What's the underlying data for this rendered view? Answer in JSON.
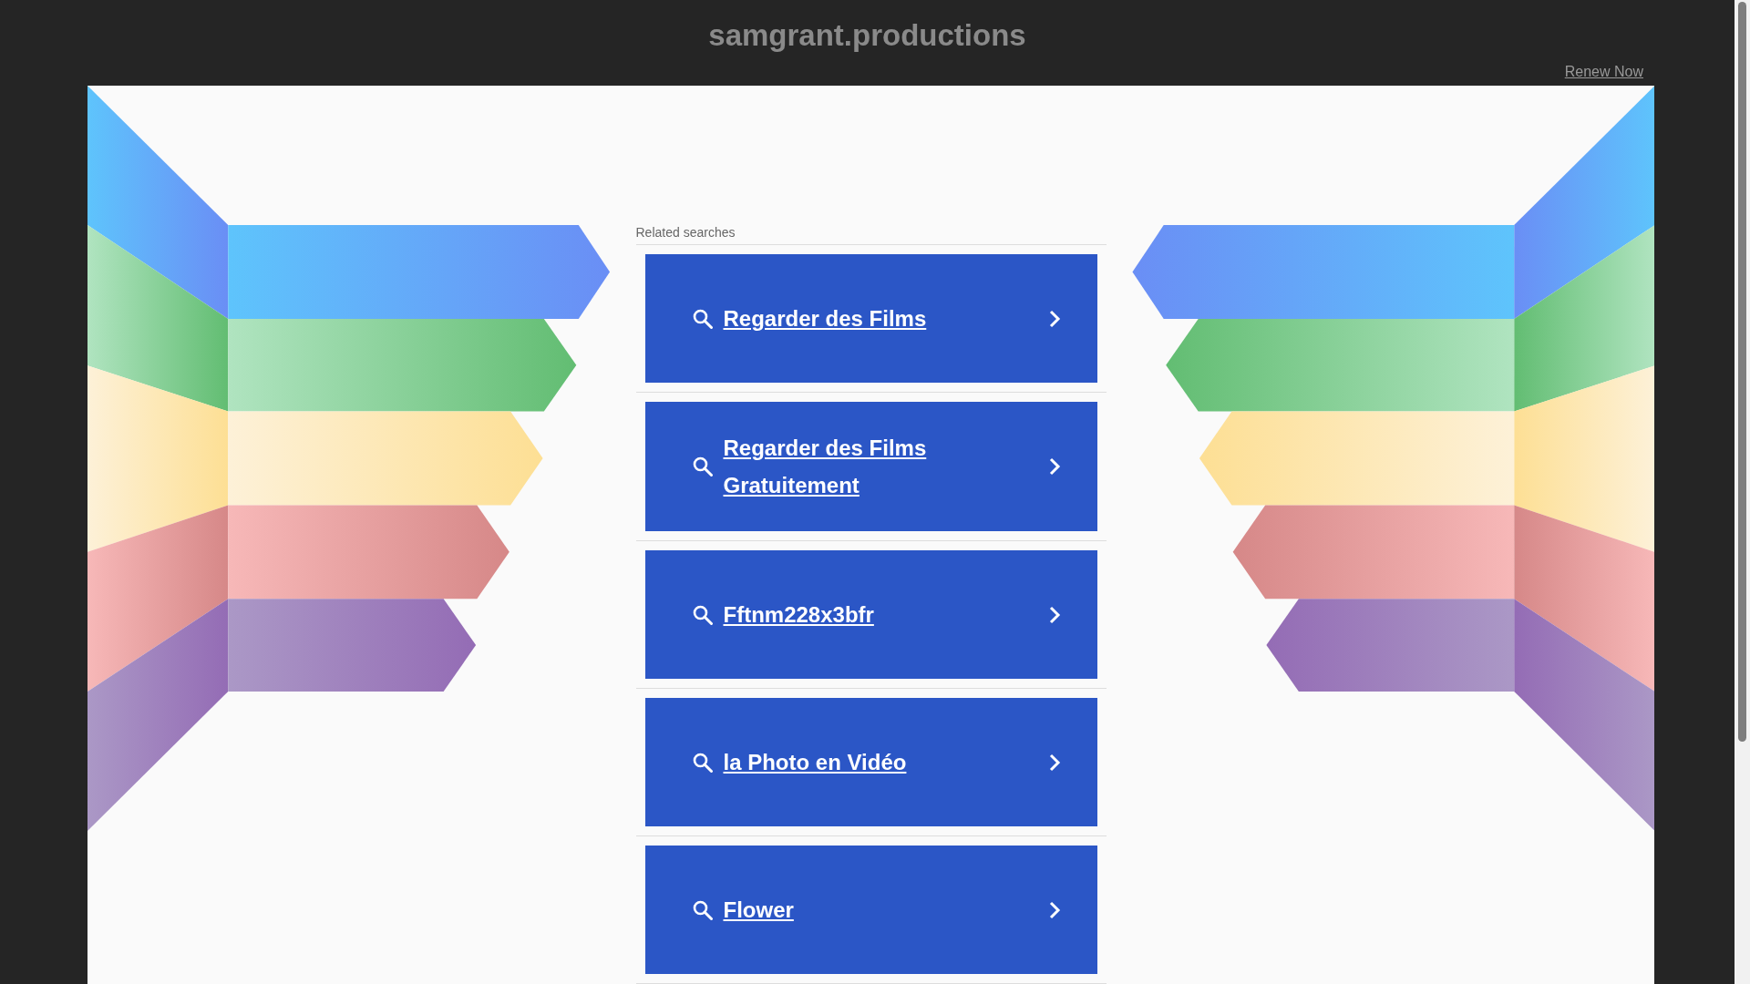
{
  "header": {
    "title": "samgrant.productions",
    "renew_link": "Renew Now"
  },
  "related": {
    "label": "Related searches",
    "items": [
      {
        "text": "Regarder des Films"
      },
      {
        "text": "Regarder des Films Gratuitement"
      },
      {
        "text": "Fftnm228x3bfr"
      },
      {
        "text": "la Photo en Vidéo"
      },
      {
        "text": "Flower"
      }
    ]
  }
}
